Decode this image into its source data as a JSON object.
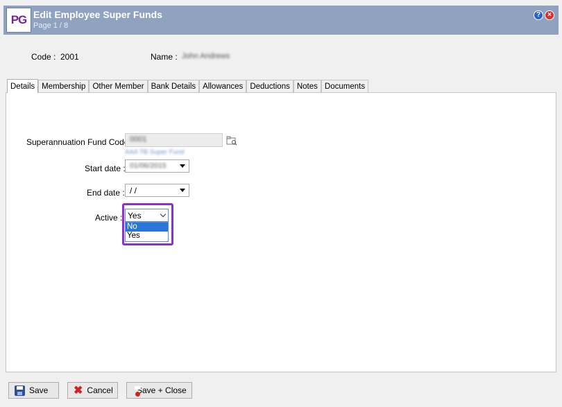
{
  "window": {
    "logo": "PG",
    "title": "Edit Employee Super Funds",
    "subtitle": "Page 1 / 8",
    "help_glyph": "?",
    "close_glyph": "×"
  },
  "header": {
    "code_label": "Code :",
    "code_value": "2001",
    "name_label": "Name :",
    "name_value": "John Andrews"
  },
  "tabs": [
    {
      "label": "Details",
      "active": true
    },
    {
      "label": "Membership"
    },
    {
      "label": "Other Member"
    },
    {
      "label": "Bank Details"
    },
    {
      "label": "Allowances"
    },
    {
      "label": "Deductions"
    },
    {
      "label": "Notes"
    },
    {
      "label": "Documents"
    }
  ],
  "form": {
    "fund_code_label": "Superannuation Fund Code :",
    "fund_code_value": "0001",
    "fund_name": "AAA TB Super Fund",
    "start_date_label": "Start date :",
    "start_date_value": "01/06/2015",
    "end_date_label": "End date :",
    "end_date_value": " /  /",
    "active_label": "Active :",
    "active_value": "Yes",
    "active_options": [
      "No",
      "Yes"
    ],
    "active_highlighted_option": "No"
  },
  "buttons": {
    "save": "Save",
    "cancel": "Cancel",
    "save_close": "Save + Close"
  },
  "colors": {
    "titlebar": "#8fa3c0",
    "highlight_border": "#8e2fd6",
    "list_selection": "#2b75d8"
  }
}
